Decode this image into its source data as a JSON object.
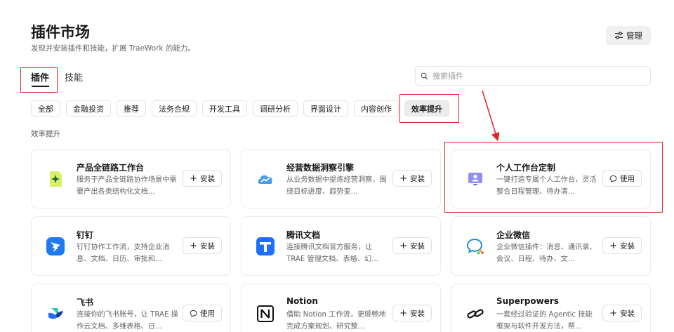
{
  "header": {
    "title": "插件市场",
    "subtitle": "发现并安装插件和技能，扩展 TraeWork 的能力。",
    "manage_label": "管理"
  },
  "tabs": [
    {
      "label": "插件",
      "active": true
    },
    {
      "label": "技能",
      "active": false
    }
  ],
  "search": {
    "placeholder": "搜索插件",
    "value": ""
  },
  "categories": [
    {
      "label": "全部",
      "active": false
    },
    {
      "label": "金融投资",
      "active": false
    },
    {
      "label": "推荐",
      "active": false
    },
    {
      "label": "法务合规",
      "active": false
    },
    {
      "label": "开发工具",
      "active": false
    },
    {
      "label": "调研分析",
      "active": false
    },
    {
      "label": "界面设计",
      "active": false
    },
    {
      "label": "内容创作",
      "active": false
    },
    {
      "label": "效率提升",
      "active": true
    }
  ],
  "section_label": "效率提升",
  "plugins": [
    {
      "name": "产品全链路工作台",
      "desc": "服务于产品全链路协作场景中需要产出各类结构化文档...",
      "action": "安装",
      "icon": "spark-doc-icon"
    },
    {
      "name": "经营数据洞察引擎",
      "desc": "从业务数据中提炼经营洞察，围绕目标进度、趋势变...",
      "action": "安装",
      "icon": "cloud-chart-icon"
    },
    {
      "name": "个人工作台定制",
      "desc": "一键打造专属个人工作台，灵活整合日程管理、待办清...",
      "action": "使用",
      "icon": "person-desk-icon"
    },
    {
      "name": "钉钉",
      "desc": "钉钉协作工作流，支持企业消息、文档、日历、审批和...",
      "action": "安装",
      "icon": "dingtalk-icon"
    },
    {
      "name": "腾讯文档",
      "desc": "连接腾讯文档官方服务，让 TRAE 管理文档、表格、幻...",
      "action": "安装",
      "icon": "tencent-docs-icon"
    },
    {
      "name": "企业微信",
      "desc": "企业微信插件：消息、通讯录、会议、日程、待办、文...",
      "action": "安装",
      "icon": "wecom-icon"
    },
    {
      "name": "飞书",
      "desc": "连接你的飞书账号，让 TRAE 操作云文档、多维表格、日...",
      "action": "使用",
      "icon": "feishu-icon"
    },
    {
      "name": "Notion",
      "desc": "借助 Notion 工作流，更顺畅地完成方案规划、研究整...",
      "action": "安装",
      "icon": "notion-icon"
    },
    {
      "name": "Superpowers",
      "desc": "一套经过验证的 Agentic 技能框架与软件开发方法，帮...",
      "action": "安装",
      "icon": "link-chain-icon"
    }
  ],
  "colors": {
    "annotation": "#e0242a",
    "accent_active_chip": "#ececec"
  }
}
